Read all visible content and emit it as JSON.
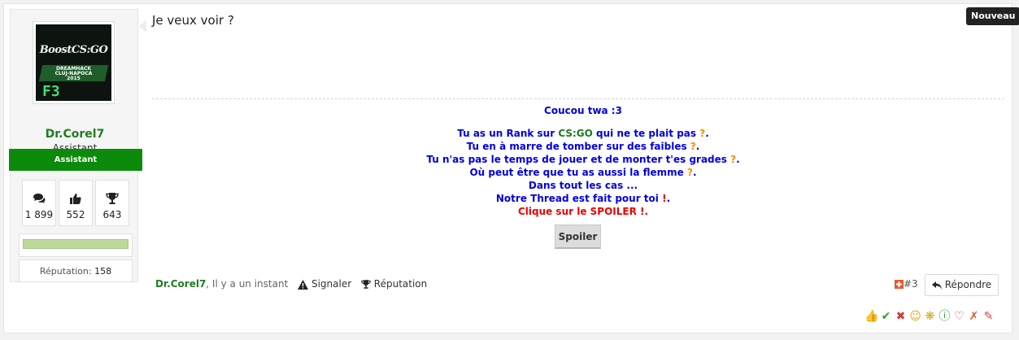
{
  "user": {
    "name": "Dr.Corel7",
    "title": "Assistant",
    "ribbon": "Assistant",
    "avatar_title": "BoostCS:GO",
    "avatar_sub1": "DREAMHACK",
    "avatar_sub2": "CLUJ-NAPOCA",
    "avatar_sub3": "2015",
    "stats": [
      {
        "icon": "chat-icon",
        "value": "1 899"
      },
      {
        "icon": "thumbs-up-icon",
        "value": "552"
      },
      {
        "icon": "trophy-icon",
        "value": "643"
      }
    ],
    "reputation_label": "Réputation:",
    "reputation_value": "158",
    "reputation_level": 1.0
  },
  "post": {
    "message": "Je veux voir ?",
    "badge": "Nouveau",
    "number": "#3"
  },
  "signature": {
    "greeting": "Coucou twa :3",
    "line1_a": "Tu as un Rank sur ",
    "line1_b": "CS:GO",
    "line1_c": " qui ne te plait pas ",
    "line1_q": "?",
    "line1_end": ".",
    "line2_a": "Tu en à marre de tomber sur des faibles ",
    "line2_q": "?",
    "line2_end": ".",
    "line3_a": "Tu n'as pas le temps de jouer et de monter t'es grades ",
    "line3_q": "?",
    "line3_end": ".",
    "line4_a": "Où peut être que tu as aussi la flemme ",
    "line4_q": "?",
    "line4_end": ".",
    "line5": "Dans tout les cas ...",
    "line6_a": "Notre Thread est fait pour toi ",
    "line6_x": "!",
    "line6_end": ".",
    "line7": "Clique sur le SPOILER !.",
    "spoiler_label": "Spoiler"
  },
  "footer": {
    "author": "Dr.Corel7",
    "time": ", Il y a un instant",
    "report": "Signaler",
    "reputation": "Réputation",
    "reply": "Répondre"
  },
  "colors": {
    "accent_green": "#207d20",
    "ribbon_green": "#0c8a0c",
    "signature_blue": "#0000e0",
    "signature_orange": "#ff8c00",
    "signature_red": "#ee0000"
  },
  "reactions": [
    "like-icon",
    "check-icon",
    "x-icon",
    "smile-icon",
    "award-icon",
    "info-icon",
    "heart-icon",
    "cross-icon",
    "pencil-icon"
  ]
}
